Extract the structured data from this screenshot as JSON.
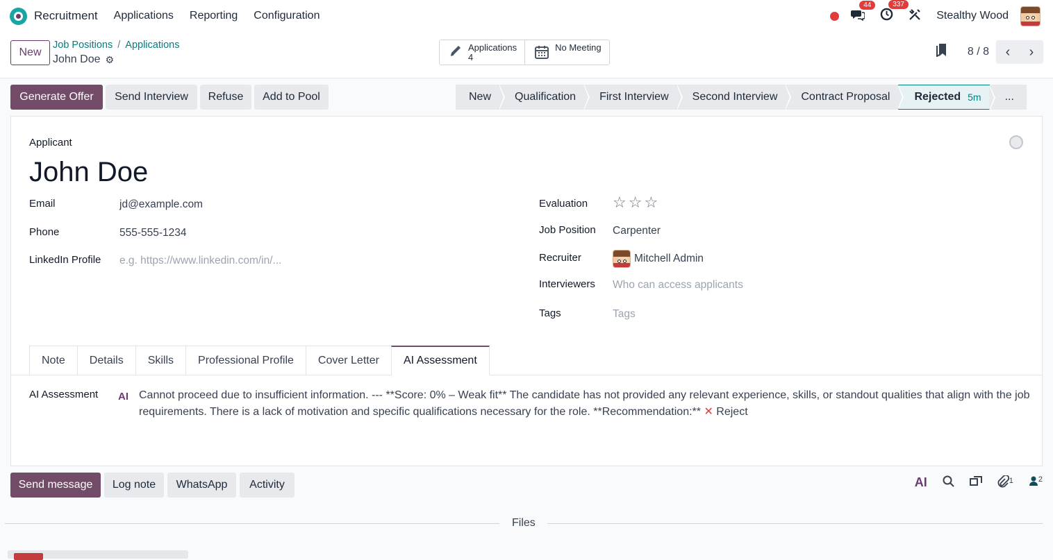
{
  "topbar": {
    "app_name": "Recruitment",
    "menu": [
      "Applications",
      "Reporting",
      "Configuration"
    ],
    "messages_count": "44",
    "activities_count": "337",
    "company": "Stealthy Wood"
  },
  "control": {
    "new_label": "New",
    "breadcrumb": [
      "Job Positions",
      "Applications"
    ],
    "breadcrumb_sep": "/",
    "record_name": "John Doe",
    "smart_buttons": {
      "applications_label": "Applications",
      "applications_count": "4",
      "meeting_label": "No Meeting"
    },
    "pager": "8 / 8"
  },
  "actions": {
    "generate_offer": "Generate Offer",
    "send_interview": "Send Interview",
    "refuse": "Refuse",
    "add_to_pool": "Add to Pool"
  },
  "stages": {
    "items": [
      "New",
      "Qualification",
      "First Interview",
      "Second Interview",
      "Contract Proposal"
    ],
    "active": "Rejected",
    "active_duration": "5m",
    "more": "..."
  },
  "form": {
    "applicant_label": "Applicant",
    "name": "John Doe",
    "email_label": "Email",
    "email": "jd@example.com",
    "phone_label": "Phone",
    "phone": "555-555-1234",
    "linkedin_label": "LinkedIn Profile",
    "linkedin_placeholder": "e.g. https://www.linkedin.com/in/...",
    "evaluation_label": "Evaluation",
    "evaluation_stars": 0,
    "job_position_label": "Job Position",
    "job_position": "Carpenter",
    "recruiter_label": "Recruiter",
    "recruiter": "Mitchell Admin",
    "interviewers_label": "Interviewers",
    "interviewers_placeholder": "Who can access applicants",
    "tags_label": "Tags",
    "tags_placeholder": "Tags"
  },
  "tabs": [
    "Note",
    "Details",
    "Skills",
    "Professional Profile",
    "Cover Letter",
    "AI Assessment"
  ],
  "active_tab": "AI Assessment",
  "ai": {
    "label": "AI Assessment",
    "icon_text": "AI",
    "text": "Cannot proceed due to insufficient information. --- **Score: 0% – Weak fit** The candidate has not provided any relevant experience, skills, or standout qualities that align with the job requirements. There is a lack of motivation and specific qualifications necessary for the role. **Recommendation:** ",
    "decision": "Reject"
  },
  "chatter": {
    "send_message": "Send message",
    "log_note": "Log note",
    "whatsapp": "WhatsApp",
    "activity": "Activity",
    "ai_icon_text": "AI",
    "attachments_count": "1",
    "followers_count": "2",
    "files_label": "Files"
  },
  "colors": {
    "primary": "#714b67",
    "link": "#017e84",
    "badge": "#e03c3c"
  }
}
